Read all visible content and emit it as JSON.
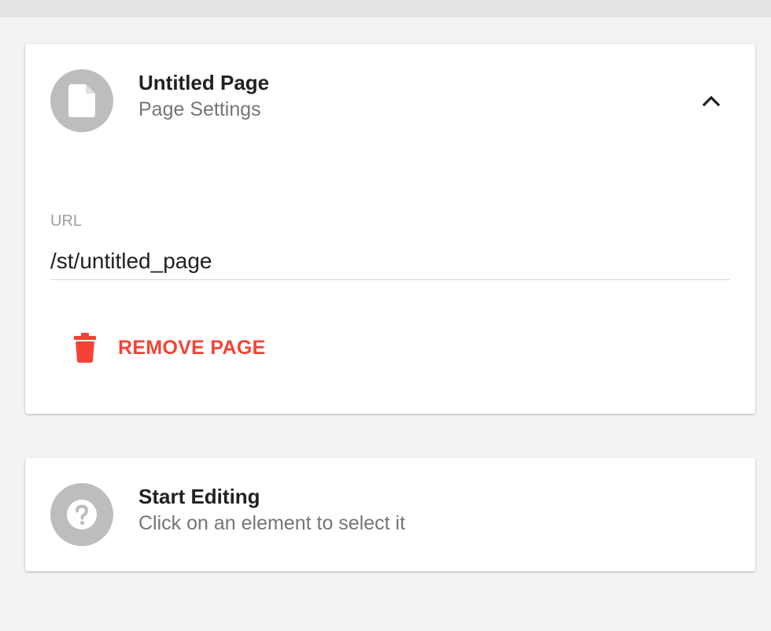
{
  "page_card": {
    "title": "Untitled Page",
    "subtitle": "Page Settings",
    "avatar_icon": "document-icon",
    "collapse_icon": "chevron-up-icon",
    "url_field": {
      "label": "URL",
      "value": "/st/untitled_page"
    },
    "remove_button": {
      "label": "REMOVE PAGE",
      "icon": "trash-icon",
      "color": "#f44336"
    }
  },
  "help_card": {
    "title": "Start Editing",
    "subtitle": "Click on an element to select it",
    "avatar_icon": "help-icon"
  },
  "colors": {
    "background": "#f3f3f3",
    "card": "#ffffff",
    "avatar": "#bdbdbd",
    "accent_danger": "#f44336"
  }
}
